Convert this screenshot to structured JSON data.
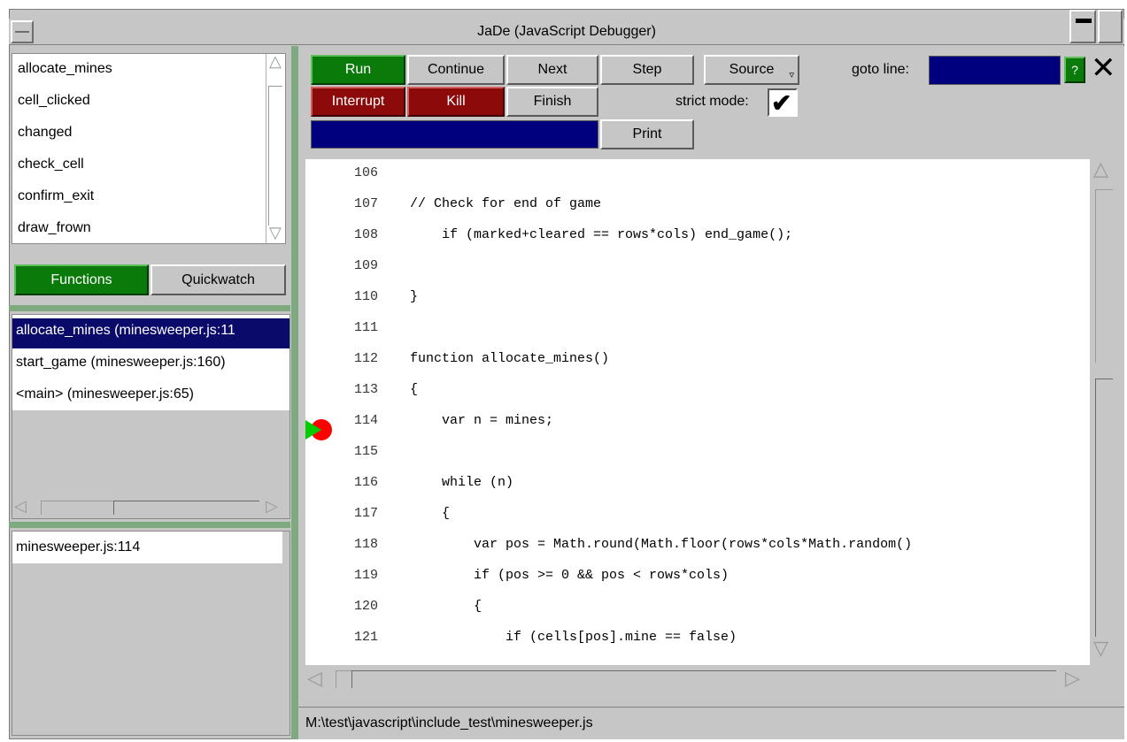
{
  "window": {
    "title": "JaDe (JavaScript Debugger)"
  },
  "functions_list": [
    "allocate_mines",
    "cell_clicked",
    "changed",
    "check_cell",
    "confirm_exit",
    "draw_frown"
  ],
  "tabs": {
    "functions": "Functions",
    "quickwatch": "Quickwatch"
  },
  "call_stack": [
    "allocate_mines (minesweeper.js:11",
    "start_game (minesweeper.js:160)",
    "<main> (minesweeper.js:65)"
  ],
  "breakpoints": [
    "minesweeper.js:114"
  ],
  "toolbar": {
    "run": "Run",
    "continue": "Continue",
    "next": "Next",
    "step": "Step",
    "source": "Source",
    "interrupt": "Interrupt",
    "kill": "Kill",
    "finish": "Finish",
    "print": "Print",
    "goto_label": "goto line:",
    "goto_value": "",
    "help": "?",
    "strict_mode_label": "strict mode:",
    "strict_mode_checked": true
  },
  "code_lines": [
    {
      "n": "106",
      "t": ""
    },
    {
      "n": "107",
      "t": "// Check for end of game"
    },
    {
      "n": "108",
      "t": "    if (marked+cleared == rows*cols) end_game();"
    },
    {
      "n": "109",
      "t": ""
    },
    {
      "n": "110",
      "t": "}"
    },
    {
      "n": "111",
      "t": ""
    },
    {
      "n": "112",
      "t": "function allocate_mines()"
    },
    {
      "n": "113",
      "t": "{"
    },
    {
      "n": "114",
      "t": "    var n = mines;"
    },
    {
      "n": "115",
      "t": ""
    },
    {
      "n": "116",
      "t": "    while (n)"
    },
    {
      "n": "117",
      "t": "    {"
    },
    {
      "n": "118",
      "t": "        var pos = Math.round(Math.floor(rows*cols*Math.random()"
    },
    {
      "n": "119",
      "t": "        if (pos >= 0 && pos < rows*cols)"
    },
    {
      "n": "120",
      "t": "        {"
    },
    {
      "n": "121",
      "t": "            if (cells[pos].mine == false)"
    }
  ],
  "current_line": "114",
  "status_path": "M:\\test\\javascript\\include_test\\minesweeper.js"
}
